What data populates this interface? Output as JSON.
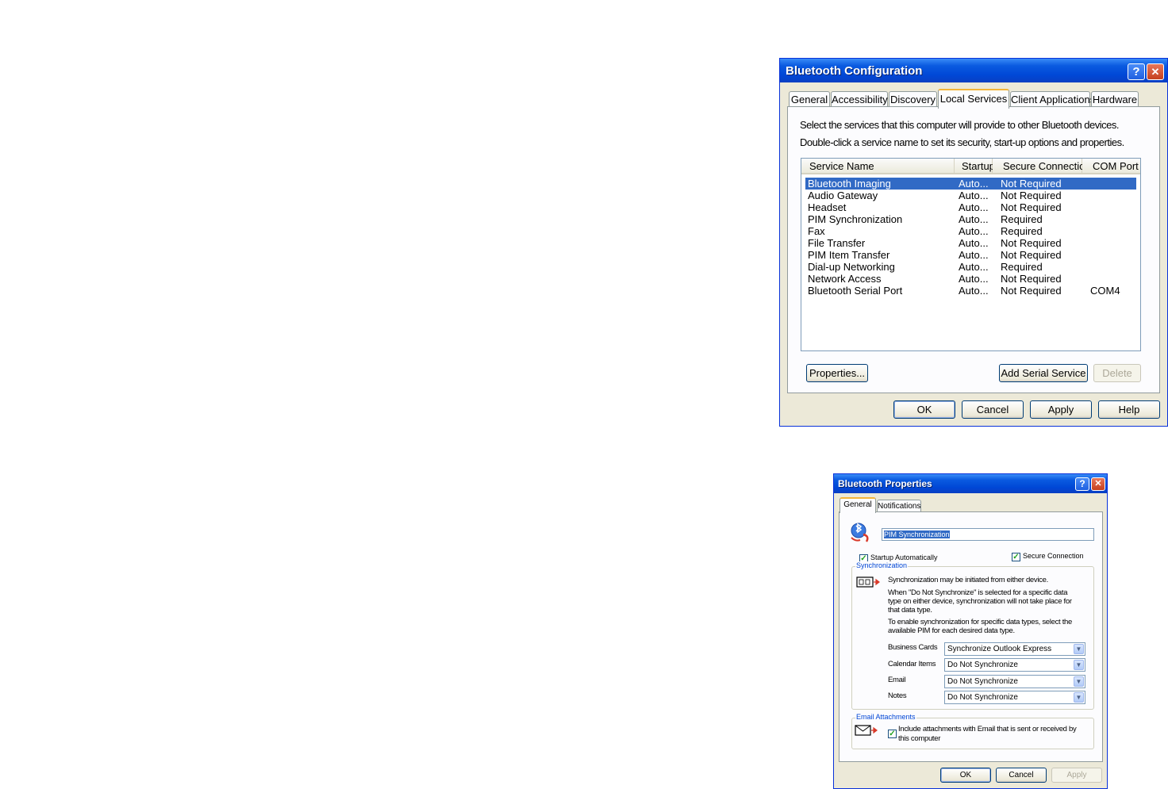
{
  "config_dialog": {
    "title": "Bluetooth Configuration",
    "tabs": [
      "General",
      "Accessibility",
      "Discovery",
      "Local Services",
      "Client Applications",
      "Hardware"
    ],
    "active_tab": "Local Services",
    "instruction_1": "Select the services that this computer will provide to other Bluetooth devices.",
    "instruction_2": "Double-click a service name to set its security, start-up options and properties.",
    "columns": [
      "Service Name",
      "Startup",
      "Secure Connection",
      "COM Port"
    ],
    "services": [
      {
        "name": "Bluetooth Imaging",
        "startup": "Auto...",
        "secure": "Not Required",
        "com": ""
      },
      {
        "name": "Audio Gateway",
        "startup": "Auto...",
        "secure": "Not Required",
        "com": ""
      },
      {
        "name": "Headset",
        "startup": "Auto...",
        "secure": "Not Required",
        "com": ""
      },
      {
        "name": "PIM Synchronization",
        "startup": "Auto...",
        "secure": "Required",
        "com": ""
      },
      {
        "name": "Fax",
        "startup": "Auto...",
        "secure": "Required",
        "com": ""
      },
      {
        "name": "File Transfer",
        "startup": "Auto...",
        "secure": "Not Required",
        "com": ""
      },
      {
        "name": "PIM Item Transfer",
        "startup": "Auto...",
        "secure": "Not Required",
        "com": ""
      },
      {
        "name": "Dial-up Networking",
        "startup": "Auto...",
        "secure": "Required",
        "com": ""
      },
      {
        "name": "Network Access",
        "startup": "Auto...",
        "secure": "Not Required",
        "com": ""
      },
      {
        "name": "Bluetooth Serial Port",
        "startup": "Auto...",
        "secure": "Not Required",
        "com": "COM4"
      }
    ],
    "selected_service": "Bluetooth Imaging",
    "properties_button": "Properties...",
    "add_serial_button": "Add Serial Service",
    "delete_button": "Delete",
    "ok_button": "OK",
    "cancel_button": "Cancel",
    "apply_button": "Apply",
    "help_button": "Help",
    "help_icon": "?",
    "close_icon": "✕"
  },
  "properties_dialog": {
    "title": "Bluetooth Properties",
    "tabs": [
      "General",
      "Notifications"
    ],
    "active_tab": "General",
    "service_name_value": "PIM Synchronization",
    "startup_auto_label": "Startup Automatically",
    "startup_auto_checked": true,
    "secure_connection_label": "Secure Connection",
    "secure_connection_checked": true,
    "sync_group_label": "Synchronization",
    "sync_text_1": "Synchronization may be initiated from either device.",
    "sync_text_2_line1": "When \"Do Not Synchronize\" is selected for a specific data",
    "sync_text_2_line2": "type on either device, synchronization will not take place for",
    "sync_text_2_line3": "that data type.",
    "sync_text_3_line1": "To enable synchronization for specific data types, select the",
    "sync_text_3_line2": "available PIM for each desired data type.",
    "data_types": [
      {
        "label": "Business Cards",
        "value": "Synchronize Outlook Express"
      },
      {
        "label": "Calendar Items",
        "value": "Do Not Synchronize"
      },
      {
        "label": "Email",
        "value": "Do Not Synchronize"
      },
      {
        "label": "Notes",
        "value": "Do Not Synchronize"
      }
    ],
    "email_group_label": "Email Attachments",
    "attachments_line1": "Include attachments with Email that is sent or received by",
    "attachments_line2": "this computer",
    "attachments_checked": true,
    "ok_button": "OK",
    "cancel_button": "Cancel",
    "apply_button": "Apply",
    "help_icon": "?",
    "close_icon": "✕",
    "checkmark": "✓",
    "dropdown_arrow": "▼"
  },
  "icons": {
    "service_icon": "bluetooth-sync-icon",
    "sync_icon": "sync-devices-icon",
    "email_icon": "envelope-icon"
  }
}
